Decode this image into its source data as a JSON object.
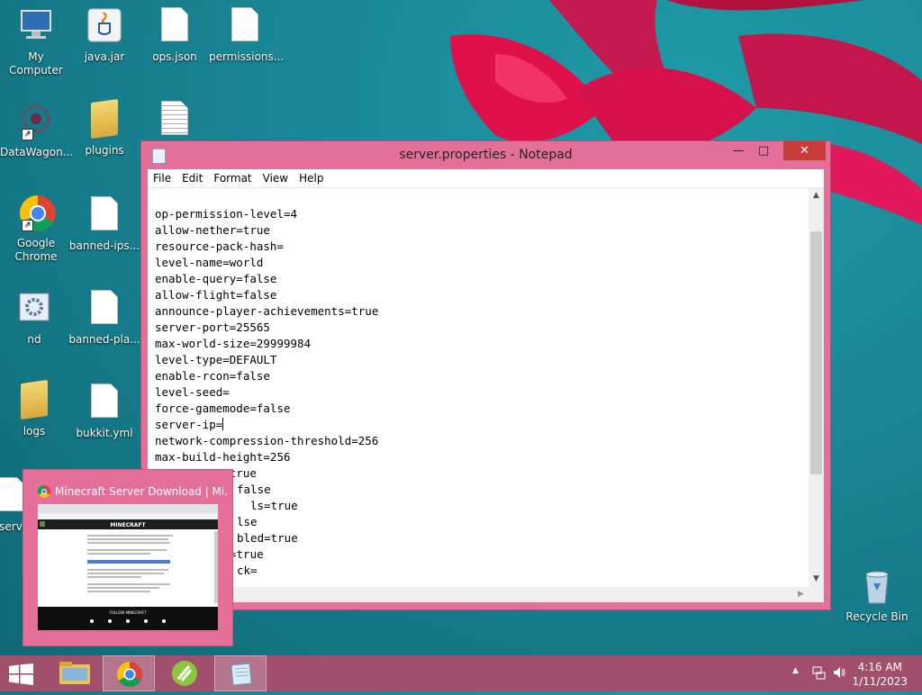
{
  "desktop": {
    "icons": [
      {
        "label": "My Computer"
      },
      {
        "label": "java.jar"
      },
      {
        "label": "ops.json"
      },
      {
        "label": "permissions..."
      },
      {
        "label": "DataWagon..."
      },
      {
        "label": "plugins"
      },
      {
        "label": "Google Chrome"
      },
      {
        "label": "banned-ips..."
      },
      {
        "label": "nd"
      },
      {
        "label": "banned-pla..."
      },
      {
        "label": "logs"
      },
      {
        "label": "bukkit.yml"
      },
      {
        "label": "Recycle Bin"
      }
    ],
    "partial_label": "serv"
  },
  "notepad": {
    "title": "server.properties - Notepad",
    "menu": [
      "File",
      "Edit",
      "Format",
      "View",
      "Help"
    ],
    "lines": [
      "op-permission-level=4",
      "allow-nether=true",
      "resource-pack-hash=",
      "level-name=world",
      "enable-query=false",
      "allow-flight=false",
      "announce-player-achievements=true",
      "server-port=25565",
      "max-world-size=29999984",
      "level-type=DEFAULT",
      "enable-rcon=false",
      "level-seed=",
      "force-gamemode=false",
      "server-ip=",
      "network-compression-threshold=256",
      "max-build-height=256",
      "spawn-npcs=true",
      "false",
      "ls=true",
      "lse",
      "bled=true",
      "=true",
      "ck="
    ]
  },
  "preview": {
    "title": "Minecraft Server Download | Mi...",
    "page_heading": "MINECRAFT",
    "footer": "FOLLOW MINECRAFT"
  },
  "taskbar": {
    "time": "4:16 AM",
    "date": "1/11/2023"
  }
}
